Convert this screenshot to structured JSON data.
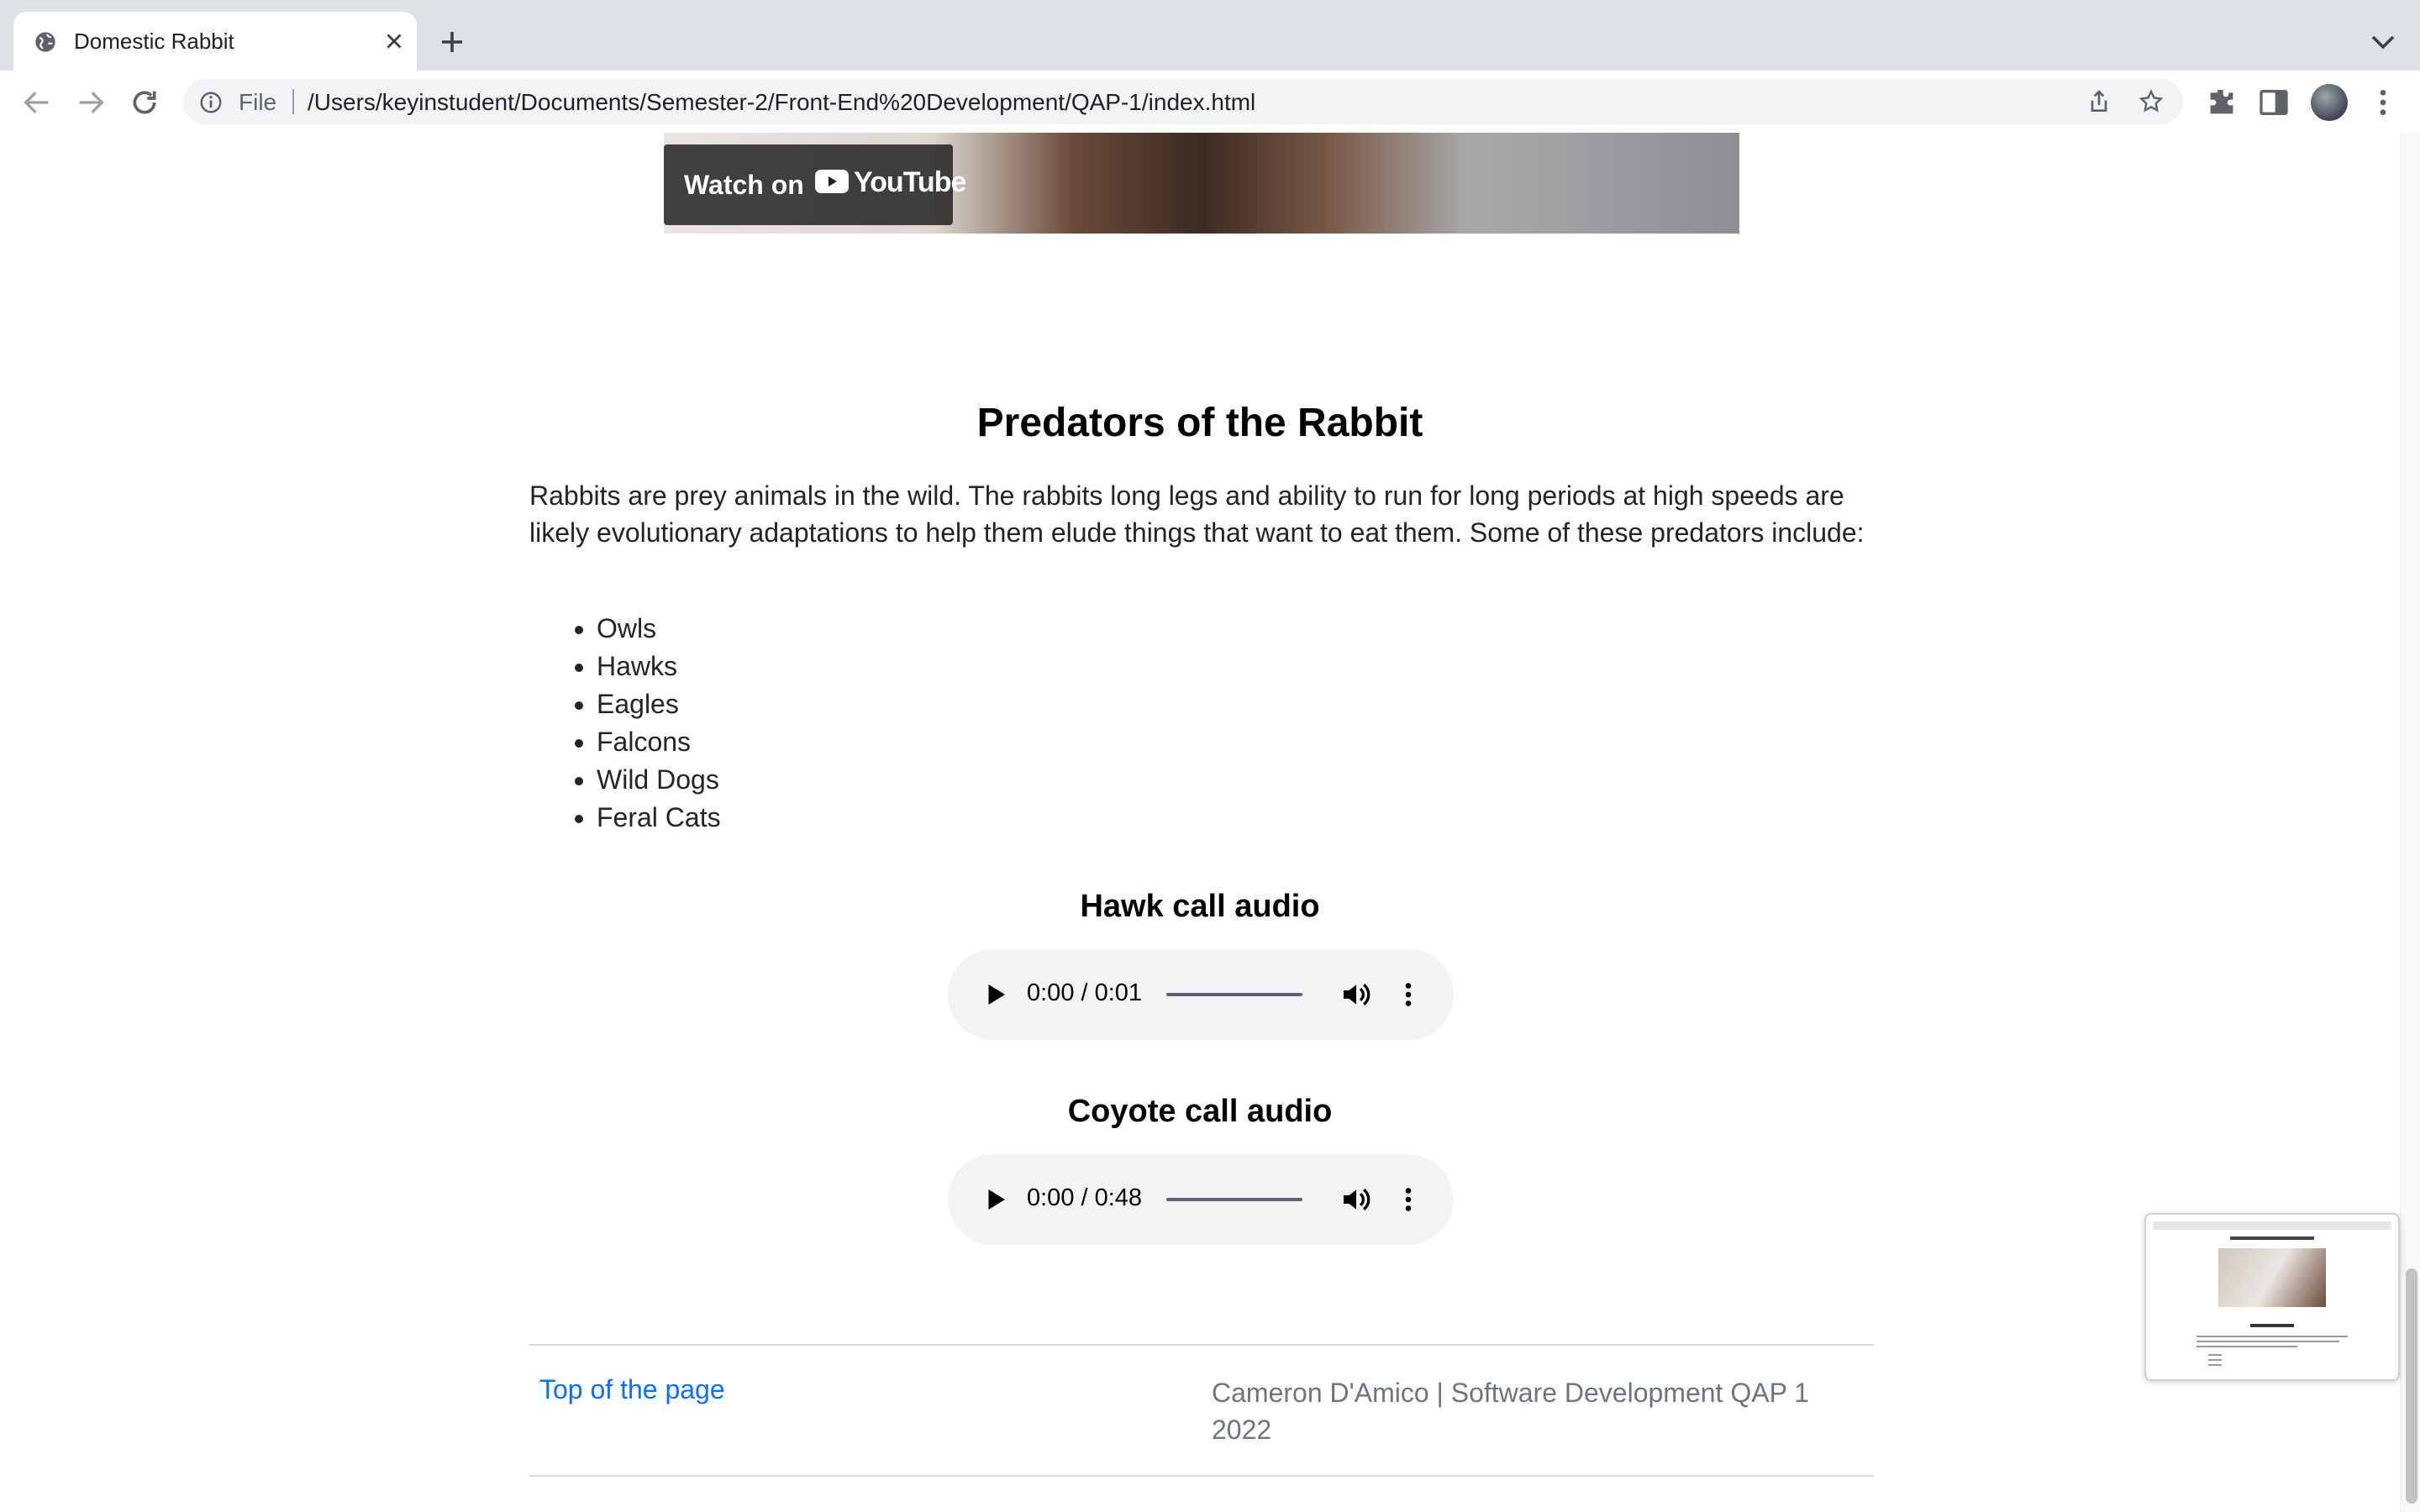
{
  "browser": {
    "tab_title": "Domestic Rabbit",
    "file_label": "File",
    "url": "/Users/keyinstudent/Documents/Semester-2/Front-End%20Development/QAP-1/index.html"
  },
  "video": {
    "watch_label": "Watch on",
    "youtube_label": "YouTube"
  },
  "predators": {
    "title": "Predators of the Rabbit",
    "intro": "Rabbits are prey animals in the wild. The rabbits long legs and ability to run for long periods at high speeds are likely evolutionary adaptations to help them elude things that want to eat them. Some of these predators include:",
    "items": [
      "Owls",
      "Hawks",
      "Eagles",
      "Falcons",
      "Wild Dogs",
      "Feral Cats"
    ]
  },
  "audio": [
    {
      "heading": "Hawk call audio",
      "time": "0:00 / 0:01"
    },
    {
      "heading": "Coyote call audio",
      "time": "0:00 / 0:48"
    }
  ],
  "footer": {
    "top_link": "Top of the page",
    "credit": "Cameron D'Amico | Software Development QAP 1 2022"
  }
}
